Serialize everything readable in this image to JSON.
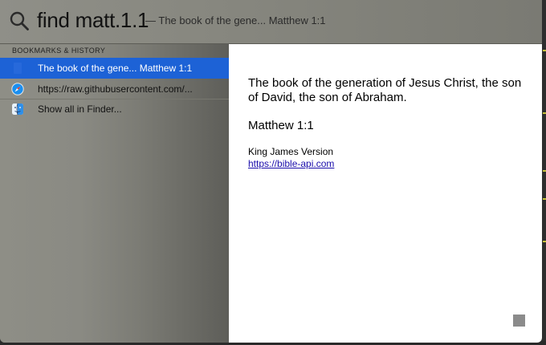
{
  "search": {
    "query": "find matt.1.1",
    "completion": "— The book of the gene... Matthew 1:1"
  },
  "results": {
    "section_header": "BOOKMARKS & HISTORY",
    "items": [
      {
        "label": "The book of the gene... Matthew 1:1",
        "icon": "page-icon",
        "selected": true
      },
      {
        "label": "https://raw.githubusercontent.com/...",
        "icon": "safari-compass-icon",
        "selected": false
      },
      {
        "label": "Show all in Finder...",
        "icon": "finder-icon",
        "selected": false
      }
    ]
  },
  "preview": {
    "verse": "The book of the generation of Jesus Christ, the son of David, the son of Abraham.",
    "reference": "Matthew 1:1",
    "version": "King James Version",
    "link": "https://bible-api.com"
  },
  "colors": {
    "selection": "#1d62d6",
    "link": "#1a0dab"
  }
}
